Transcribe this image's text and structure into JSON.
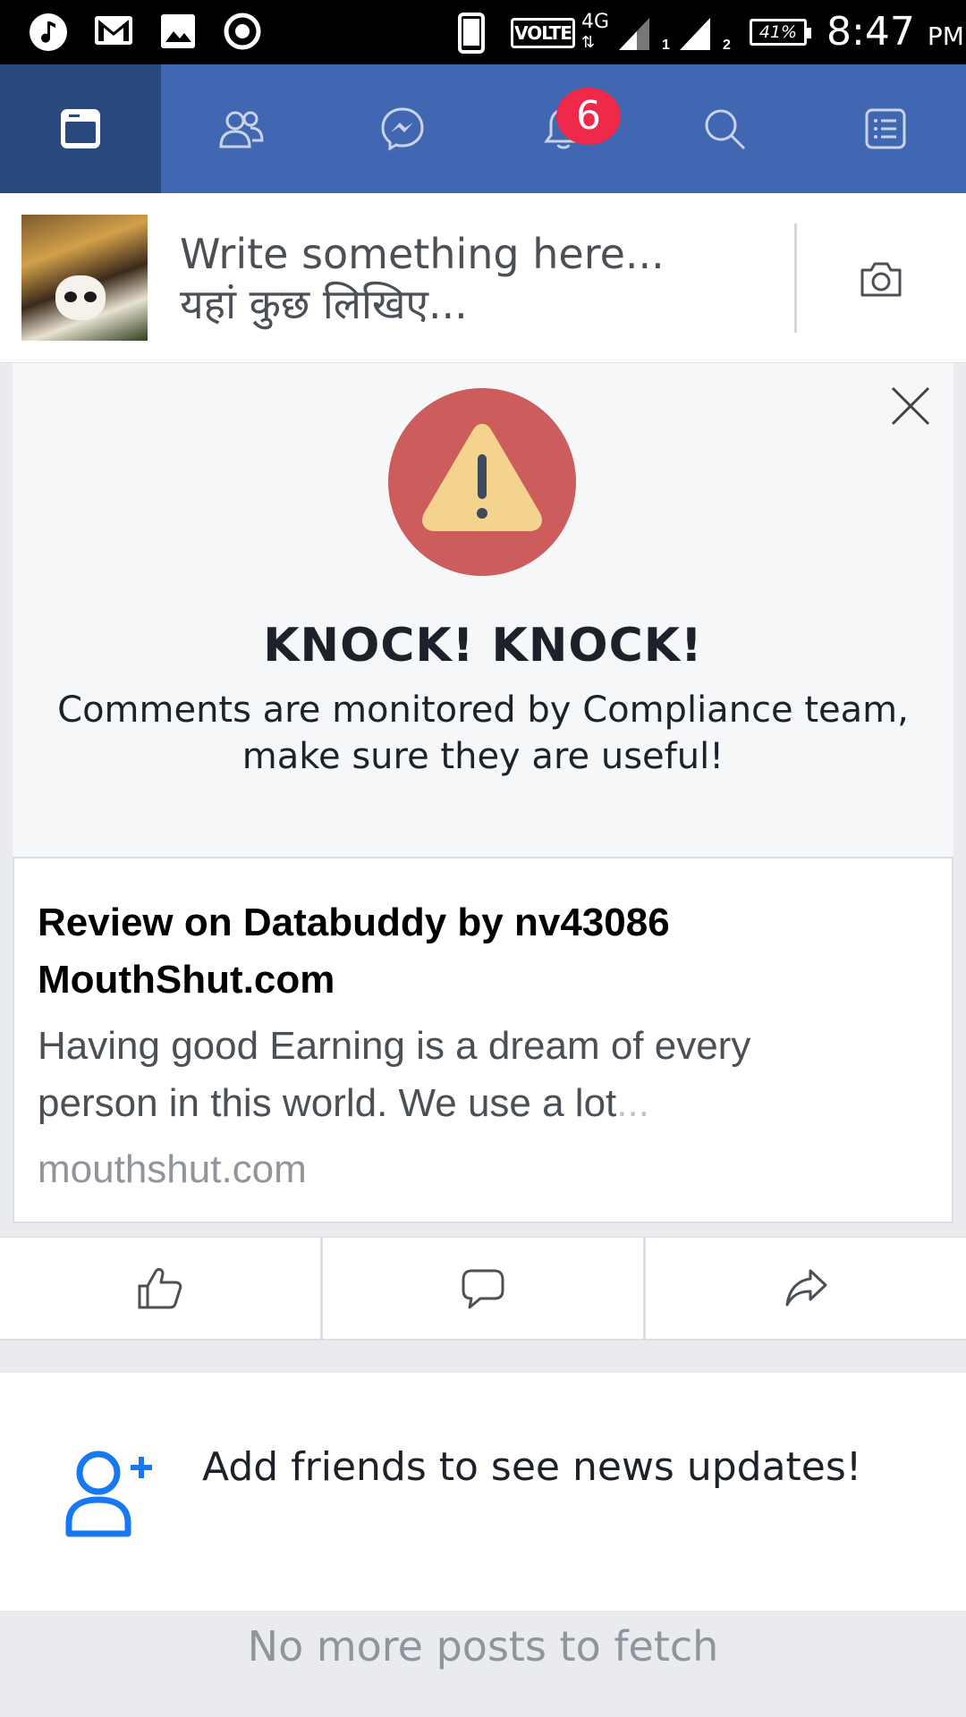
{
  "status_bar": {
    "icons_left": [
      "music-note-icon",
      "gmail-icon",
      "gallery-icon",
      "record-icon"
    ],
    "volte": "VOLTE",
    "network": "4G",
    "sim_labels": [
      "1",
      "2"
    ],
    "battery": "41%",
    "time": "8:47",
    "ampm": "PM"
  },
  "nav": {
    "tabs": [
      {
        "name": "news-feed",
        "icon": "news-feed-icon",
        "active": true
      },
      {
        "name": "friends",
        "icon": "friends-icon",
        "active": false
      },
      {
        "name": "messenger",
        "icon": "messenger-icon",
        "active": false
      },
      {
        "name": "notifications",
        "icon": "bell-icon",
        "active": false
      },
      {
        "name": "search",
        "icon": "search-icon",
        "active": false
      },
      {
        "name": "menu",
        "icon": "menu-list-icon",
        "active": false
      }
    ],
    "notification_count": "6"
  },
  "composer": {
    "placeholder_line1": "Write something here...",
    "placeholder_line2": "यहां कुछ लिखिए..."
  },
  "notice": {
    "title": "KNOCK! KNOCK!",
    "line1": "Comments are monitored by Compliance team,",
    "line2": "make sure they are useful!"
  },
  "link_card": {
    "title_line1": "Review on Databuddy by nv43086",
    "title_line2": "MouthShut.com",
    "desc_line1": "Having good Earning is a dream of every",
    "desc_line2": "person in this world. We use a lot",
    "desc_ellipsis": "...",
    "domain": "mouthshut.com"
  },
  "actions": [
    "like-icon",
    "comment-icon",
    "share-icon"
  ],
  "add_friends": {
    "text": "Add friends to see news updates!"
  },
  "footer": {
    "text": "No more posts to fetch"
  },
  "colors": {
    "nav_bg": "#4267b2",
    "nav_active": "#29487d",
    "badge": "#f02849",
    "warning_circle": "#cd5c5c",
    "warning_triangle": "#f4d38e",
    "friend_icon": "#1877f2"
  }
}
